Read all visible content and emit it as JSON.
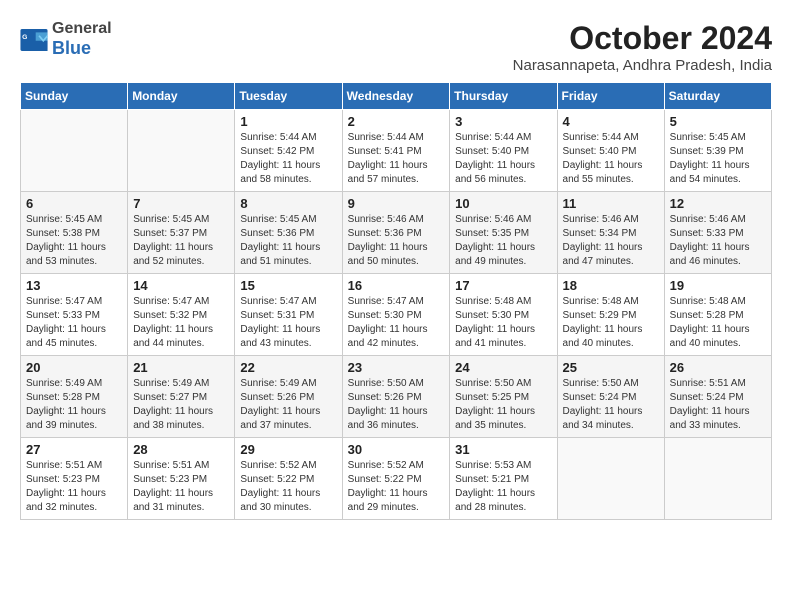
{
  "logo": {
    "general": "General",
    "blue": "Blue"
  },
  "title": "October 2024",
  "subtitle": "Narasannapeta, Andhra Pradesh, India",
  "days_of_week": [
    "Sunday",
    "Monday",
    "Tuesday",
    "Wednesday",
    "Thursday",
    "Friday",
    "Saturday"
  ],
  "weeks": [
    [
      {
        "day": "",
        "sunrise": "",
        "sunset": "",
        "daylight": ""
      },
      {
        "day": "",
        "sunrise": "",
        "sunset": "",
        "daylight": ""
      },
      {
        "day": "1",
        "sunrise": "Sunrise: 5:44 AM",
        "sunset": "Sunset: 5:42 PM",
        "daylight": "Daylight: 11 hours and 58 minutes."
      },
      {
        "day": "2",
        "sunrise": "Sunrise: 5:44 AM",
        "sunset": "Sunset: 5:41 PM",
        "daylight": "Daylight: 11 hours and 57 minutes."
      },
      {
        "day": "3",
        "sunrise": "Sunrise: 5:44 AM",
        "sunset": "Sunset: 5:40 PM",
        "daylight": "Daylight: 11 hours and 56 minutes."
      },
      {
        "day": "4",
        "sunrise": "Sunrise: 5:44 AM",
        "sunset": "Sunset: 5:40 PM",
        "daylight": "Daylight: 11 hours and 55 minutes."
      },
      {
        "day": "5",
        "sunrise": "Sunrise: 5:45 AM",
        "sunset": "Sunset: 5:39 PM",
        "daylight": "Daylight: 11 hours and 54 minutes."
      }
    ],
    [
      {
        "day": "6",
        "sunrise": "Sunrise: 5:45 AM",
        "sunset": "Sunset: 5:38 PM",
        "daylight": "Daylight: 11 hours and 53 minutes."
      },
      {
        "day": "7",
        "sunrise": "Sunrise: 5:45 AM",
        "sunset": "Sunset: 5:37 PM",
        "daylight": "Daylight: 11 hours and 52 minutes."
      },
      {
        "day": "8",
        "sunrise": "Sunrise: 5:45 AM",
        "sunset": "Sunset: 5:36 PM",
        "daylight": "Daylight: 11 hours and 51 minutes."
      },
      {
        "day": "9",
        "sunrise": "Sunrise: 5:46 AM",
        "sunset": "Sunset: 5:36 PM",
        "daylight": "Daylight: 11 hours and 50 minutes."
      },
      {
        "day": "10",
        "sunrise": "Sunrise: 5:46 AM",
        "sunset": "Sunset: 5:35 PM",
        "daylight": "Daylight: 11 hours and 49 minutes."
      },
      {
        "day": "11",
        "sunrise": "Sunrise: 5:46 AM",
        "sunset": "Sunset: 5:34 PM",
        "daylight": "Daylight: 11 hours and 47 minutes."
      },
      {
        "day": "12",
        "sunrise": "Sunrise: 5:46 AM",
        "sunset": "Sunset: 5:33 PM",
        "daylight": "Daylight: 11 hours and 46 minutes."
      }
    ],
    [
      {
        "day": "13",
        "sunrise": "Sunrise: 5:47 AM",
        "sunset": "Sunset: 5:33 PM",
        "daylight": "Daylight: 11 hours and 45 minutes."
      },
      {
        "day": "14",
        "sunrise": "Sunrise: 5:47 AM",
        "sunset": "Sunset: 5:32 PM",
        "daylight": "Daylight: 11 hours and 44 minutes."
      },
      {
        "day": "15",
        "sunrise": "Sunrise: 5:47 AM",
        "sunset": "Sunset: 5:31 PM",
        "daylight": "Daylight: 11 hours and 43 minutes."
      },
      {
        "day": "16",
        "sunrise": "Sunrise: 5:47 AM",
        "sunset": "Sunset: 5:30 PM",
        "daylight": "Daylight: 11 hours and 42 minutes."
      },
      {
        "day": "17",
        "sunrise": "Sunrise: 5:48 AM",
        "sunset": "Sunset: 5:30 PM",
        "daylight": "Daylight: 11 hours and 41 minutes."
      },
      {
        "day": "18",
        "sunrise": "Sunrise: 5:48 AM",
        "sunset": "Sunset: 5:29 PM",
        "daylight": "Daylight: 11 hours and 40 minutes."
      },
      {
        "day": "19",
        "sunrise": "Sunrise: 5:48 AM",
        "sunset": "Sunset: 5:28 PM",
        "daylight": "Daylight: 11 hours and 40 minutes."
      }
    ],
    [
      {
        "day": "20",
        "sunrise": "Sunrise: 5:49 AM",
        "sunset": "Sunset: 5:28 PM",
        "daylight": "Daylight: 11 hours and 39 minutes."
      },
      {
        "day": "21",
        "sunrise": "Sunrise: 5:49 AM",
        "sunset": "Sunset: 5:27 PM",
        "daylight": "Daylight: 11 hours and 38 minutes."
      },
      {
        "day": "22",
        "sunrise": "Sunrise: 5:49 AM",
        "sunset": "Sunset: 5:26 PM",
        "daylight": "Daylight: 11 hours and 37 minutes."
      },
      {
        "day": "23",
        "sunrise": "Sunrise: 5:50 AM",
        "sunset": "Sunset: 5:26 PM",
        "daylight": "Daylight: 11 hours and 36 minutes."
      },
      {
        "day": "24",
        "sunrise": "Sunrise: 5:50 AM",
        "sunset": "Sunset: 5:25 PM",
        "daylight": "Daylight: 11 hours and 35 minutes."
      },
      {
        "day": "25",
        "sunrise": "Sunrise: 5:50 AM",
        "sunset": "Sunset: 5:24 PM",
        "daylight": "Daylight: 11 hours and 34 minutes."
      },
      {
        "day": "26",
        "sunrise": "Sunrise: 5:51 AM",
        "sunset": "Sunset: 5:24 PM",
        "daylight": "Daylight: 11 hours and 33 minutes."
      }
    ],
    [
      {
        "day": "27",
        "sunrise": "Sunrise: 5:51 AM",
        "sunset": "Sunset: 5:23 PM",
        "daylight": "Daylight: 11 hours and 32 minutes."
      },
      {
        "day": "28",
        "sunrise": "Sunrise: 5:51 AM",
        "sunset": "Sunset: 5:23 PM",
        "daylight": "Daylight: 11 hours and 31 minutes."
      },
      {
        "day": "29",
        "sunrise": "Sunrise: 5:52 AM",
        "sunset": "Sunset: 5:22 PM",
        "daylight": "Daylight: 11 hours and 30 minutes."
      },
      {
        "day": "30",
        "sunrise": "Sunrise: 5:52 AM",
        "sunset": "Sunset: 5:22 PM",
        "daylight": "Daylight: 11 hours and 29 minutes."
      },
      {
        "day": "31",
        "sunrise": "Sunrise: 5:53 AM",
        "sunset": "Sunset: 5:21 PM",
        "daylight": "Daylight: 11 hours and 28 minutes."
      },
      {
        "day": "",
        "sunrise": "",
        "sunset": "",
        "daylight": ""
      },
      {
        "day": "",
        "sunrise": "",
        "sunset": "",
        "daylight": ""
      }
    ]
  ]
}
